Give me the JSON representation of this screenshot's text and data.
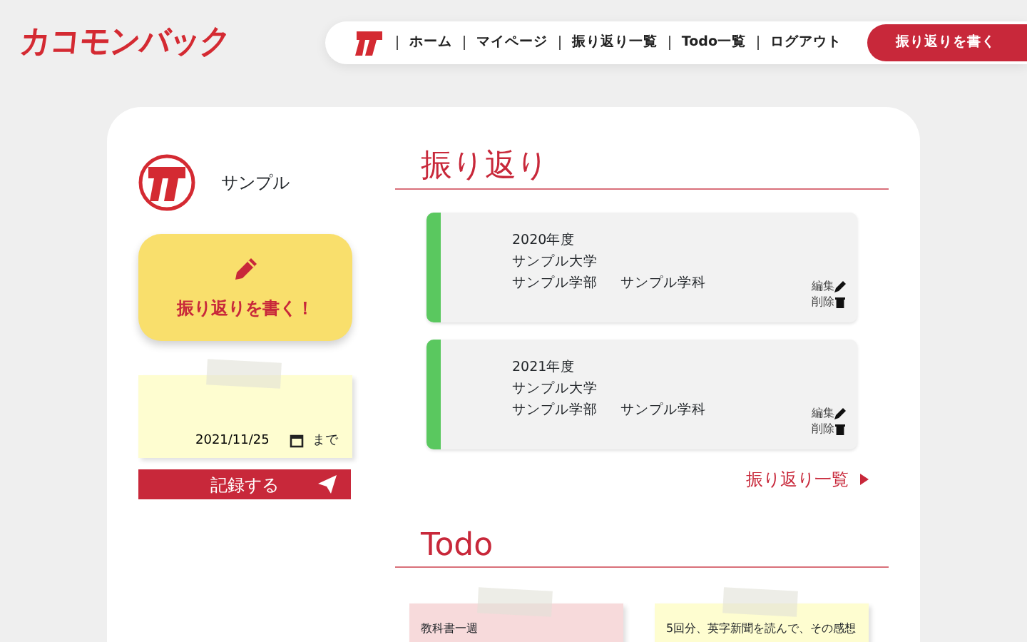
{
  "logo": "カコモンバック",
  "nav": {
    "items": [
      {
        "label": "ホーム"
      },
      {
        "label": "マイページ"
      },
      {
        "label": "振り返り一覧"
      },
      {
        "label": "Todo一覧"
      },
      {
        "label": "ログアウト"
      }
    ],
    "cta": "振り返りを書く"
  },
  "profile": {
    "name": "サンプル"
  },
  "write_button": "振り返りを書く！",
  "todo_form": {
    "date": "2021/11/25",
    "suffix": "まで",
    "submit": "記録する"
  },
  "reflections": {
    "title": "振り返り",
    "items": [
      {
        "year": "2020年度",
        "university": "サンプル大学",
        "faculty": "サンプル学部",
        "department": "サンプル学科",
        "color": "#5ac85f",
        "edit": "編集",
        "delete": "削除"
      },
      {
        "year": "2021年度",
        "university": "サンプル大学",
        "faculty": "サンプル学部",
        "department": "サンプル学科",
        "color": "#5ac85f",
        "edit": "編集",
        "delete": "削除"
      }
    ],
    "more": "振り返り一覧"
  },
  "todo": {
    "title": "Todo",
    "items": [
      {
        "text": "教科書一週",
        "color": "#f7dadb"
      },
      {
        "text": "5回分、英字新聞を読んで、その感想",
        "color": "#fefdd0"
      }
    ]
  }
}
